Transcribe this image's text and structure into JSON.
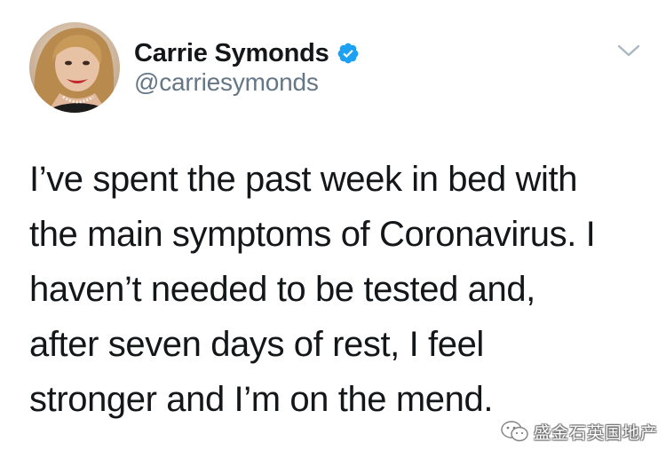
{
  "tweet": {
    "author": {
      "display_name": "Carrie Symonds",
      "handle": "@carriesymonds",
      "verified": true
    },
    "text_lines": [
      "I’ve spent the past week in bed with",
      "the main symptoms of Coronavirus. I",
      "haven’t needed to be tested and,",
      "after seven days of rest, I feel",
      "stronger and I’m on the mend."
    ],
    "menu_icon": "chevron-down-icon"
  },
  "watermark": {
    "icon": "wechat-icon",
    "text": "盛金石英国地产"
  },
  "colors": {
    "text": "#14171a",
    "secondary": "#657786",
    "verified_blue": "#1da1f2",
    "background": "#ffffff"
  }
}
